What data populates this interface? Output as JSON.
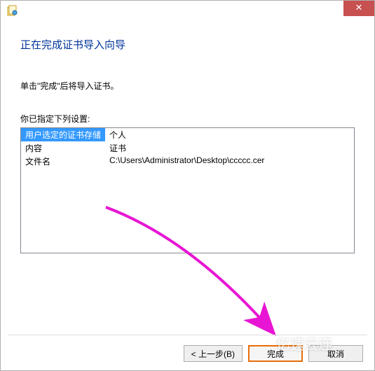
{
  "dialog": {
    "heading": "正在完成证书导入向导",
    "instruction": "单击\"完成\"后将导入证书。",
    "settings_label": "你已指定下列设置:",
    "rows": [
      {
        "key": "用户选定的证书存储",
        "value": "个人",
        "selected": true
      },
      {
        "key": "内容",
        "value": "证书",
        "selected": false
      },
      {
        "key": "文件名",
        "value": "C:\\Users\\Administrator\\Desktop\\ccccc.cer",
        "selected": false
      }
    ]
  },
  "buttons": {
    "back": "< 上一步(B)",
    "finish": "完成",
    "cancel": "取消"
  },
  "titlebar": {
    "close_glyph": "✕"
  },
  "watermark": "亿速云连"
}
